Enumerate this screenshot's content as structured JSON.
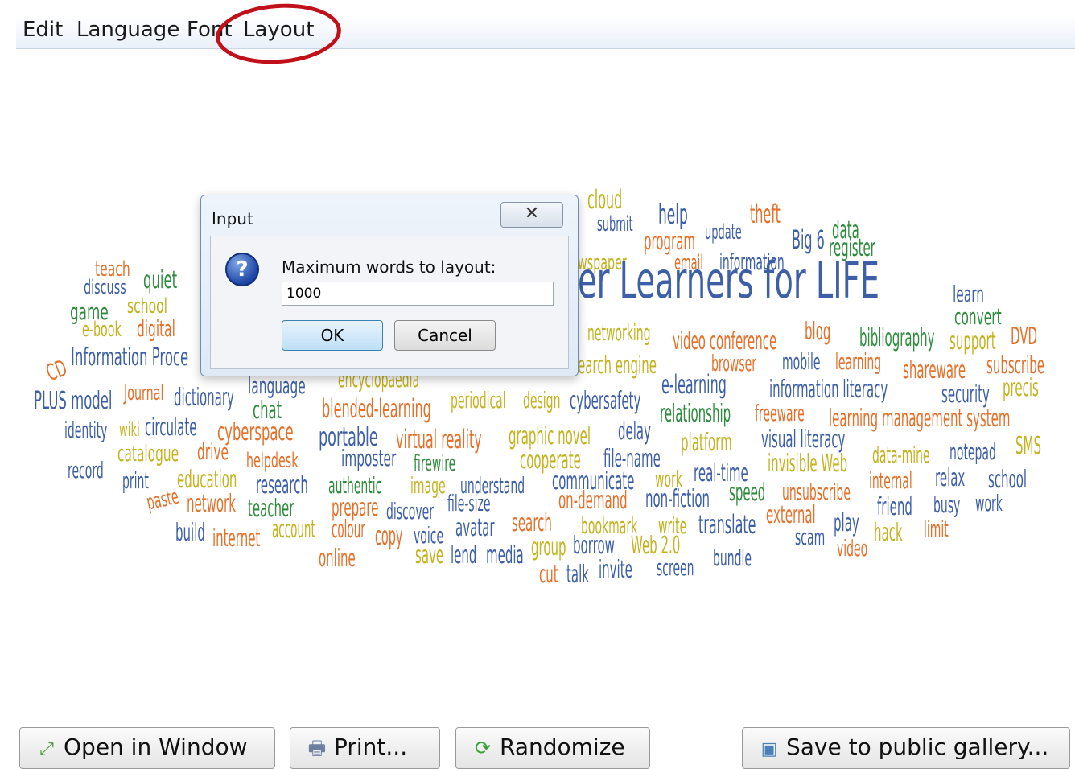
{
  "menu": {
    "edit": "Edit",
    "language": "Language",
    "font": "Font",
    "layout": "Layout"
  },
  "dialog": {
    "title": "Input",
    "close_glyph": "✕",
    "question_icon": "question-icon",
    "prompt": "Maximum words to layout:",
    "input_value": "1000",
    "ok_label": "OK",
    "cancel_label": "Cancel"
  },
  "cloud": {
    "words": [
      "teach",
      "discuss",
      "quiet",
      "game",
      "school",
      "e-book",
      "digital",
      "Information Proce",
      "CD",
      "PLUS model",
      "Journal",
      "dictionary",
      "language",
      "chat",
      "identity",
      "wiki",
      "circulate",
      "cyberspace",
      "portable",
      "catalogue",
      "drive",
      "helpdesk",
      "imposter",
      "record",
      "print",
      "education",
      "research",
      "authentic",
      "paste",
      "network",
      "teacher",
      "prepare",
      "build",
      "internet",
      "account",
      "colour",
      "copy",
      "online",
      "cloud",
      "submit",
      "help",
      "theft",
      "program",
      "update",
      "Big 6",
      "data",
      "register",
      "wspaper",
      "email",
      "information",
      "er Learners for LIFE",
      "learn",
      "convert",
      "networking",
      "video conference",
      "blog",
      "bibliography",
      "support",
      "DVD",
      "earch engine",
      "browser",
      "mobile",
      "learning",
      "shareware",
      "subscribe",
      "encyclopaedia",
      "e-learning",
      "information literacy",
      "security",
      "precis",
      "blended-learning",
      "periodical",
      "design",
      "cybersafety",
      "relationship",
      "freeware",
      "learning management system",
      "virtual reality",
      "graphic novel",
      "delay",
      "platform",
      "visual literacy",
      "firewire",
      "cooperate",
      "file-name",
      "invisible Web",
      "data-mine",
      "notepad",
      "SMS",
      "image",
      "understand",
      "communicate",
      "work",
      "real-time",
      "internal",
      "relax",
      "school",
      "discover",
      "file-size",
      "on-demand",
      "non-fiction",
      "speed",
      "unsubscribe",
      "friend",
      "busy",
      "work",
      "voice",
      "avatar",
      "search",
      "bookmark",
      "write",
      "translate",
      "external",
      "play",
      "hack",
      "limit",
      "save",
      "lend",
      "media",
      "group",
      "borrow",
      "Web 2.0",
      "scam",
      "video",
      "cut",
      "talk",
      "invite",
      "screen",
      "bundle"
    ]
  },
  "bottom": {
    "open_window": "Open in Window",
    "print": "Print...",
    "randomize": "Randomize",
    "save_gallery": "Save to public gallery..."
  }
}
